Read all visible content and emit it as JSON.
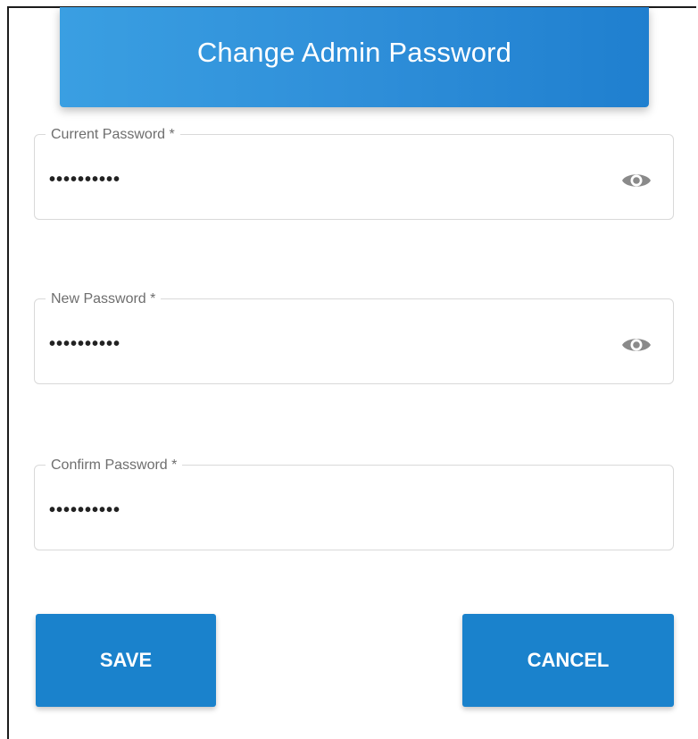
{
  "dialog": {
    "title": "Change Admin Password"
  },
  "fields": {
    "current": {
      "label": "Current Password *",
      "value": "••••••••••",
      "icon": "eye-icon"
    },
    "new": {
      "label": "New Password *",
      "value": "••••••••••",
      "icon": "eye-icon"
    },
    "confirm": {
      "label": "Confirm Password *",
      "value": "••••••••••"
    }
  },
  "actions": {
    "save_label": "SAVE",
    "cancel_label": "CANCEL"
  },
  "colors": {
    "accent": "#1a82cc",
    "header_gradient_start": "#3a9fe2",
    "header_gradient_end": "#1f7fcf",
    "icon": "#8a8a8a"
  }
}
